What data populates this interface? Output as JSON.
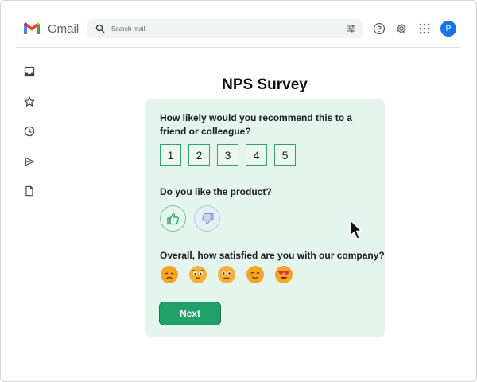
{
  "header": {
    "app_name": "Gmail",
    "search_placeholder": "Search mail",
    "avatar_initial": "P",
    "icons": [
      "help-icon",
      "settings-gear-icon",
      "apps-grid-icon"
    ]
  },
  "sidebar": {
    "icons": [
      "inbox-icon",
      "star-icon",
      "clock-icon",
      "send-icon",
      "document-icon"
    ]
  },
  "survey": {
    "title": "NPS Survey",
    "question_recommend": "How likely would you recommend this to a friend or colleague?",
    "ratings": [
      "1",
      "2",
      "3",
      "4",
      "5"
    ],
    "question_like": "Do you like the product?",
    "question_satisfied": "Overall, how satisfied are you with our company?",
    "satisfaction_icons": [
      "sad-face-icon",
      "worried-face-icon",
      "neutral-face-icon",
      "smiling-face-icon",
      "heart-eyes-face-icon"
    ],
    "next_label": "Next"
  },
  "colors": {
    "card_bg": "#e3f5ec",
    "accent": "#21a06a",
    "rating_border": "#36a06a",
    "avatar": "#1a73e8"
  }
}
